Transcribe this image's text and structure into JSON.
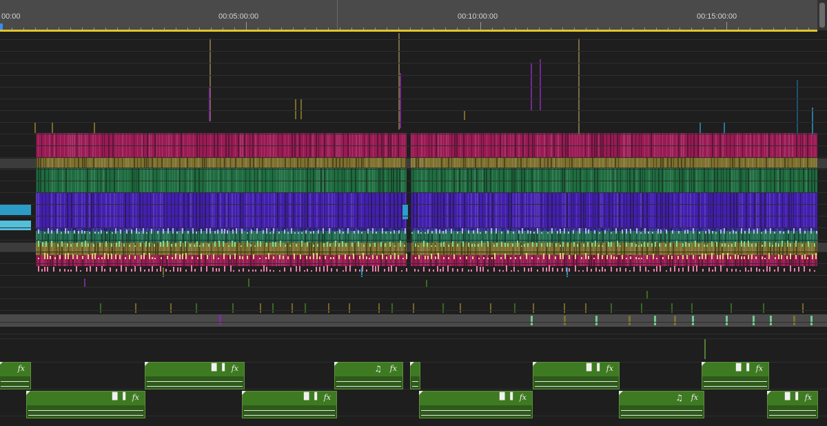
{
  "ruler": {
    "timecodes": [
      "00:00",
      "00:05:00:00",
      "00:10:00:00",
      "00:15:00:00"
    ]
  },
  "colors": {
    "magenta": "#b01a5e",
    "olive": "#8a7a2a",
    "green": "#1f7a45",
    "violet": "#4a20c8",
    "cyan": "#2ea8d8",
    "lime": "#3e7a22",
    "workarea": "#e2c62a",
    "playhead": "#3a8cf0"
  },
  "audio_clips": {
    "icons": [
      "waveform-icon",
      "music-note-icon",
      "fx-badge"
    ],
    "fx_label": "fx",
    "waveform_glyph": "▐▌▐",
    "note_glyph": "♫"
  }
}
